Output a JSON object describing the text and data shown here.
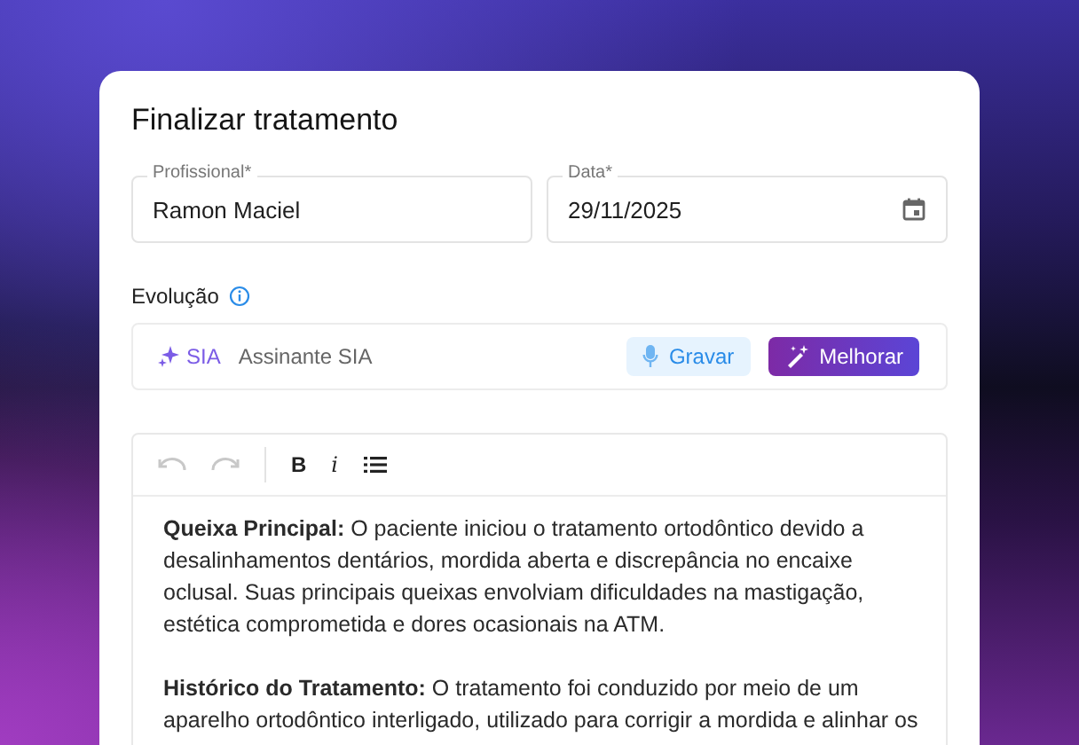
{
  "dialog": {
    "title": "Finalizar tratamento"
  },
  "fields": [
    {
      "kind": "text",
      "label": "Profissional*",
      "value": "Ramon Maciel"
    },
    {
      "kind": "date",
      "label": "Data*",
      "value": "29/11/2025"
    }
  ],
  "evolution": {
    "label": "Evolução",
    "assistant": {
      "brand": "SIA",
      "name": "Assinante SIA"
    },
    "buttons": [
      {
        "kind": "record",
        "label": "Gravar"
      },
      {
        "kind": "improve",
        "label": "Melhorar"
      }
    ]
  },
  "editor": {
    "toolbar": [
      {
        "kind": "undo",
        "disabled": true
      },
      {
        "kind": "redo",
        "disabled": true
      },
      {
        "kind": "divider"
      },
      {
        "kind": "bold",
        "label": "B",
        "disabled": false
      },
      {
        "kind": "italic",
        "label": "i",
        "disabled": false
      },
      {
        "kind": "list",
        "disabled": false
      }
    ],
    "paragraphs": [
      "**Queixa Principal:** O paciente iniciou o tratamento ortodôntico devido a desalinhamentos dentários, mordida aberta e discrepância no encaixe oclusal. Suas principais queixas envolviam dificuldades na mastigação, estética comprometida e dores ocasionais na ATM.",
      "**Histórico do Tratamento:** O tratamento foi conduzido por meio de um aparelho ortodôntico interligado, utilizado para corrigir a mordida e alinhar os"
    ]
  }
}
